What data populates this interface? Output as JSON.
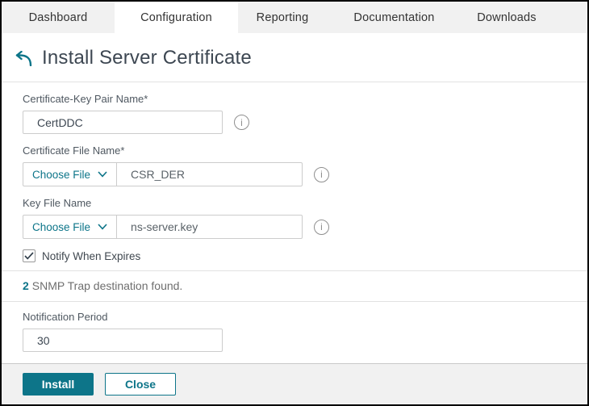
{
  "colors": {
    "accent_teal": "#0d7589",
    "tabbar_bg": "#f1f1f1",
    "footer_bg": "#f1f1f1",
    "title_text": "#3d4752"
  },
  "tabs": [
    {
      "label": "Dashboard",
      "active": false
    },
    {
      "label": "Configuration",
      "active": true
    },
    {
      "label": "Reporting",
      "active": false
    },
    {
      "label": "Documentation",
      "active": false
    },
    {
      "label": "Downloads",
      "active": false
    }
  ],
  "page": {
    "title": "Install Server Certificate"
  },
  "form": {
    "cert_key_pair": {
      "label": "Certificate-Key Pair Name*",
      "value": "CertDDC"
    },
    "cert_file": {
      "label": "Certificate File Name*",
      "choose_button": "Choose File",
      "value": "CSR_DER"
    },
    "key_file": {
      "label": "Key File Name",
      "choose_button": "Choose File",
      "value": "ns-server.key"
    },
    "notify_checkbox": {
      "label": "Notify When Expires",
      "checked": true
    },
    "snmp_notice": {
      "count": "2",
      "text": "SNMP Trap destination found."
    },
    "notification_period": {
      "label": "Notification Period",
      "value": "30"
    }
  },
  "footer": {
    "install_label": "Install",
    "close_label": "Close"
  }
}
